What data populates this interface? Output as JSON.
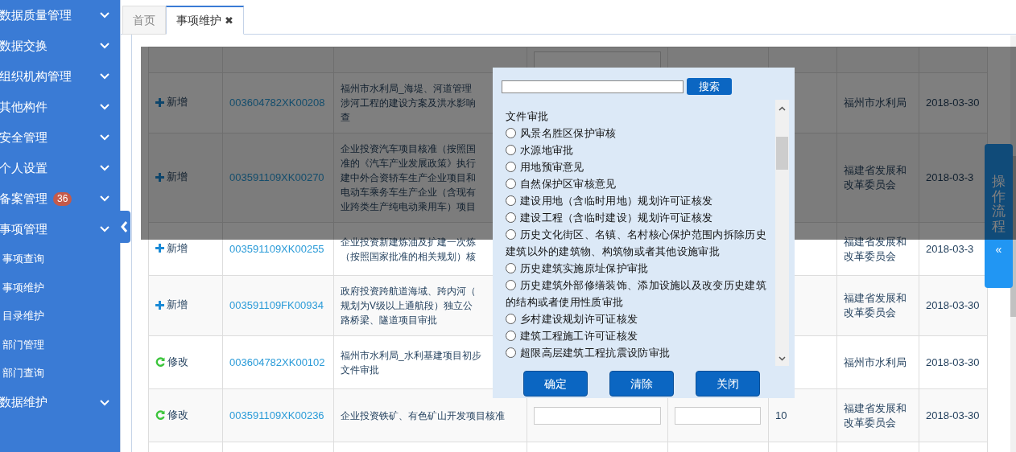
{
  "sidebar": {
    "items": [
      {
        "label": "数据质量管理"
      },
      {
        "label": "数据交换"
      },
      {
        "label": "组织机构管理"
      },
      {
        "label": "其他构件"
      },
      {
        "label": "安全管理"
      },
      {
        "label": "个人设置"
      },
      {
        "label": "备案管理",
        "badge": "36"
      },
      {
        "label": "事项管理",
        "children": [
          {
            "label": "事项查询",
            "selected": false
          },
          {
            "label": "事项维护",
            "selected": false
          },
          {
            "label": "目录维护",
            "selected": false
          },
          {
            "label": "部门管理",
            "selected": false
          },
          {
            "label": "部门查询",
            "selected": false
          }
        ]
      },
      {
        "label": "数据维护"
      }
    ]
  },
  "tabs": [
    {
      "label": "首页",
      "selected": false
    },
    {
      "label": "事项维护",
      "selected": true,
      "close": "✖"
    }
  ],
  "table": {
    "rows": [
      {
        "action": {
          "kind": "add",
          "label": "新增"
        },
        "code": "003604782XK00208",
        "description": [
          "福州市水利局_海堤、河道管理",
          "涉河工程的建设方案及洪水影响",
          "查"
        ],
        "department": [
          "福州市水利局"
        ],
        "date": "2018-03-30"
      },
      {
        "action": {
          "kind": "add",
          "label": "新增"
        },
        "code": "003591109XK00270",
        "description": [
          "企业投资汽车项目核准（按照国",
          "准的《汽车产业发展政策》执行",
          "建中外合资轿车生产企业项目和",
          "电动车乘务车生产企业（含现有",
          "业跨类生产纯电动乘用车）项目"
        ],
        "department": [
          "福建省发展和",
          "改革委员会"
        ],
        "date": "2018-03-3"
      },
      {
        "action": {
          "kind": "add",
          "label": "新增"
        },
        "code": "003591109XK00255",
        "description": [
          "企业投资新建炼油及扩建一次炼",
          "（按照国家批准的相关规划）核"
        ],
        "department": [
          "福建省发展和",
          "改革委员会"
        ],
        "date": "2018-03-3"
      },
      {
        "action": {
          "kind": "add",
          "label": "新增"
        },
        "code": "003591109FK00934",
        "description": [
          "政府投资跨航道海域、跨内河（",
          "规划为V级以上通航段）独立公",
          "路桥梁、隧道项目审批"
        ],
        "department": [
          "福建省发展和",
          "改革委员会"
        ],
        "date": "2018-03-30"
      },
      {
        "action": {
          "kind": "modify",
          "label": "修改"
        },
        "code": "003604782XK00102",
        "description": [
          "福州市水利局_水利基建项目初步",
          "文件审批"
        ],
        "department": [
          "福州市水利局"
        ],
        "date": "2018-03-30"
      },
      {
        "action": {
          "kind": "modify",
          "label": "修改"
        },
        "code": "003591109XK00236",
        "description": [
          "企业投资铁矿、有色矿山开发项目核准"
        ],
        "input_fields": true,
        "count": "10",
        "department": [
          "福建省发展和",
          "改革委员会"
        ],
        "date": "2018-03-30"
      }
    ]
  },
  "side_tab": {
    "chars": [
      "操",
      "作",
      "流",
      "程"
    ],
    "arrow": "«"
  },
  "dialog": {
    "search_button": "搜索",
    "items": [
      {
        "kind": "continuation",
        "label": "文件审批"
      },
      {
        "kind": "radio",
        "label": "风景名胜区保护审核",
        "selected": false
      },
      {
        "kind": "radio",
        "label": "水源地审批",
        "selected": false
      },
      {
        "kind": "radio",
        "label": "用地预审意见",
        "selected": false
      },
      {
        "kind": "radio",
        "label": "自然保护区审核意见",
        "selected": false
      },
      {
        "kind": "radio",
        "label": "建设用地（含临时用地）规划许可证核发",
        "selected": false
      },
      {
        "kind": "radio",
        "label": "建设工程（含临时建设）规划许可证核发",
        "selected": false
      },
      {
        "kind": "radio",
        "label": "历史文化街区、名镇、名村核心保护范围内拆除历史建筑以外的建筑物、构筑物或者其他设施审批",
        "selected": false
      },
      {
        "kind": "radio",
        "label": "历史建筑实施原址保护审批",
        "selected": false
      },
      {
        "kind": "radio",
        "label": "历史建筑外部修缮装饰、添加设施以及改变历史建筑的结构或者使用性质审批",
        "selected": false
      },
      {
        "kind": "radio",
        "label": "乡村建设规划许可证核发",
        "selected": false
      },
      {
        "kind": "radio",
        "label": "建筑工程施工许可证核发",
        "selected": false
      },
      {
        "kind": "radio",
        "label": "超限高层建筑工程抗震设防审批",
        "selected": false
      }
    ],
    "buttons": [
      "确定",
      "清除",
      "关闭"
    ]
  }
}
